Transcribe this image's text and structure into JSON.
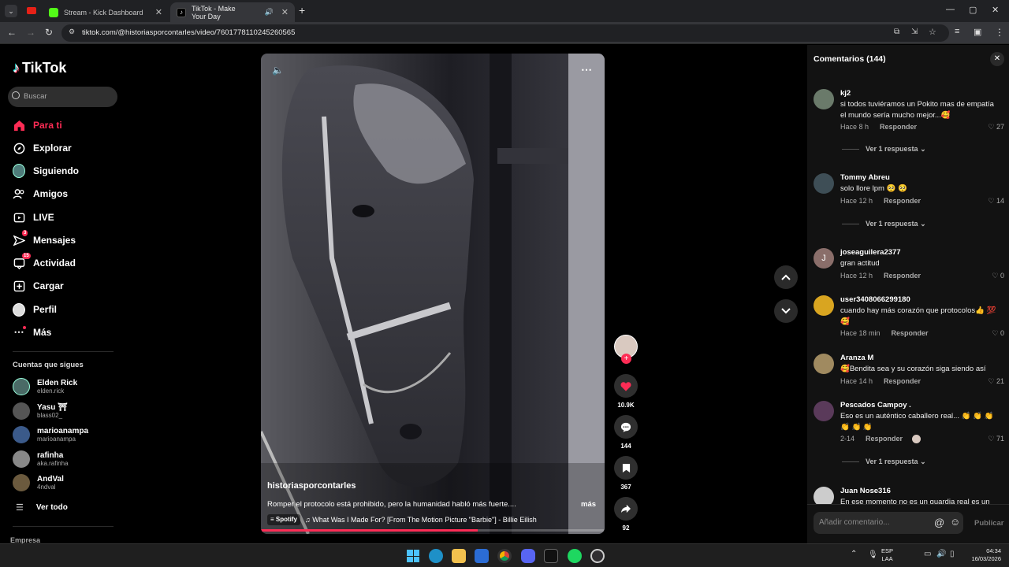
{
  "browser": {
    "tabs": [
      {
        "title": "Stream - Kick Dashboard"
      },
      {
        "title": "TikTok - Make Your Day"
      }
    ],
    "url": "tiktok.com/@historiasporcontarles/video/7601778110245260565",
    "new_tab": "+",
    "colors": {
      "kick": "#53fc18",
      "tiktok": "#000000"
    }
  },
  "sidebar": {
    "logo": "TikTok",
    "search_placeholder": "Buscar",
    "nav": [
      {
        "label": "Para ti",
        "icon": "home-icon",
        "active": true
      },
      {
        "label": "Explorar",
        "icon": "compass-icon"
      },
      {
        "label": "Siguiendo",
        "icon": "following-avatar-icon"
      },
      {
        "label": "Amigos",
        "icon": "friends-icon"
      },
      {
        "label": "LIVE",
        "icon": "live-icon"
      },
      {
        "label": "Mensajes",
        "icon": "messages-icon",
        "badge": "3"
      },
      {
        "label": "Actividad",
        "icon": "activity-icon",
        "badge": "15"
      },
      {
        "label": "Cargar",
        "icon": "upload-icon"
      },
      {
        "label": "Perfil",
        "icon": "profile-icon"
      },
      {
        "label": "Más",
        "icon": "more-icon"
      }
    ],
    "following_title": "Cuentas que sigues",
    "following": [
      {
        "name": "Elden Rick",
        "handle": "elden.rick"
      },
      {
        "name": "Yasu ⛩",
        "handle": "blass02_"
      },
      {
        "name": "marioanampa",
        "handle": "marioanampa"
      },
      {
        "name": "rafinha",
        "handle": "aka.rafinha"
      },
      {
        "name": "AndVal",
        "handle": "4ndval"
      }
    ],
    "see_all": "Ver todo",
    "company": "Empresa"
  },
  "video": {
    "author": "historiasporcontarles",
    "caption": "Romper el protocolo está prohibido, pero la humanidad habló más fuerte....",
    "more": "más",
    "music_source": "Spotify",
    "music": "What Was I Made For? [From The Motion Picture \"Barbie\"] - Billie Eilish",
    "progress": 0.63,
    "actions": {
      "likes": "10.9K",
      "comments": "144",
      "saves": "367",
      "shares": "92"
    }
  },
  "comments": {
    "title": "Comentarios",
    "count": "(144)",
    "items": [
      {
        "user": "kj2",
        "text": "si todos tuviéramos un Pokito mas de empatía el mundo sería mucho mejor...🥰",
        "time": "Hace 8 h",
        "reply": "Responder",
        "likes": "27",
        "replies": "Ver 1 respuesta"
      },
      {
        "user": "Tommy Abreu",
        "text": "solo llore lpm 🥺 🥺",
        "time": "Hace 12 h",
        "reply": "Responder",
        "likes": "14",
        "replies": "Ver 1 respuesta"
      },
      {
        "user": "joseaguilera2377",
        "text": "gran actitud",
        "time": "Hace 12 h",
        "reply": "Responder",
        "likes": "0",
        "avatar_letter": "J"
      },
      {
        "user": "user3408066299180",
        "text": "cuando hay más corazón que protocolos👍 💯 🥰",
        "time": "Hace 18 min",
        "reply": "Responder",
        "likes": "0"
      },
      {
        "user": "Aranza M",
        "text": "🥰Bendita sea y su corazón siga siendo así",
        "time": "Hace 14 h",
        "reply": "Responder",
        "likes": "21"
      },
      {
        "user": "Pescados Campoy .",
        "text": "Eso es un auténtico caballero real... 👏 👏 👏 👏 👏 👏",
        "time": "2-14",
        "reply": "Responder",
        "likes": "71",
        "replies": "Ver 1 respuesta"
      },
      {
        "user": "Juan Nose316",
        "text": "En ese momento no es un guardia real es un"
      }
    ],
    "input_placeholder": "Añadir comentario...",
    "publish": "Publicar"
  },
  "taskbar": {
    "lang": "ESP",
    "lang2": "LAA",
    "time": "04:34",
    "date": "16/03/2026"
  }
}
